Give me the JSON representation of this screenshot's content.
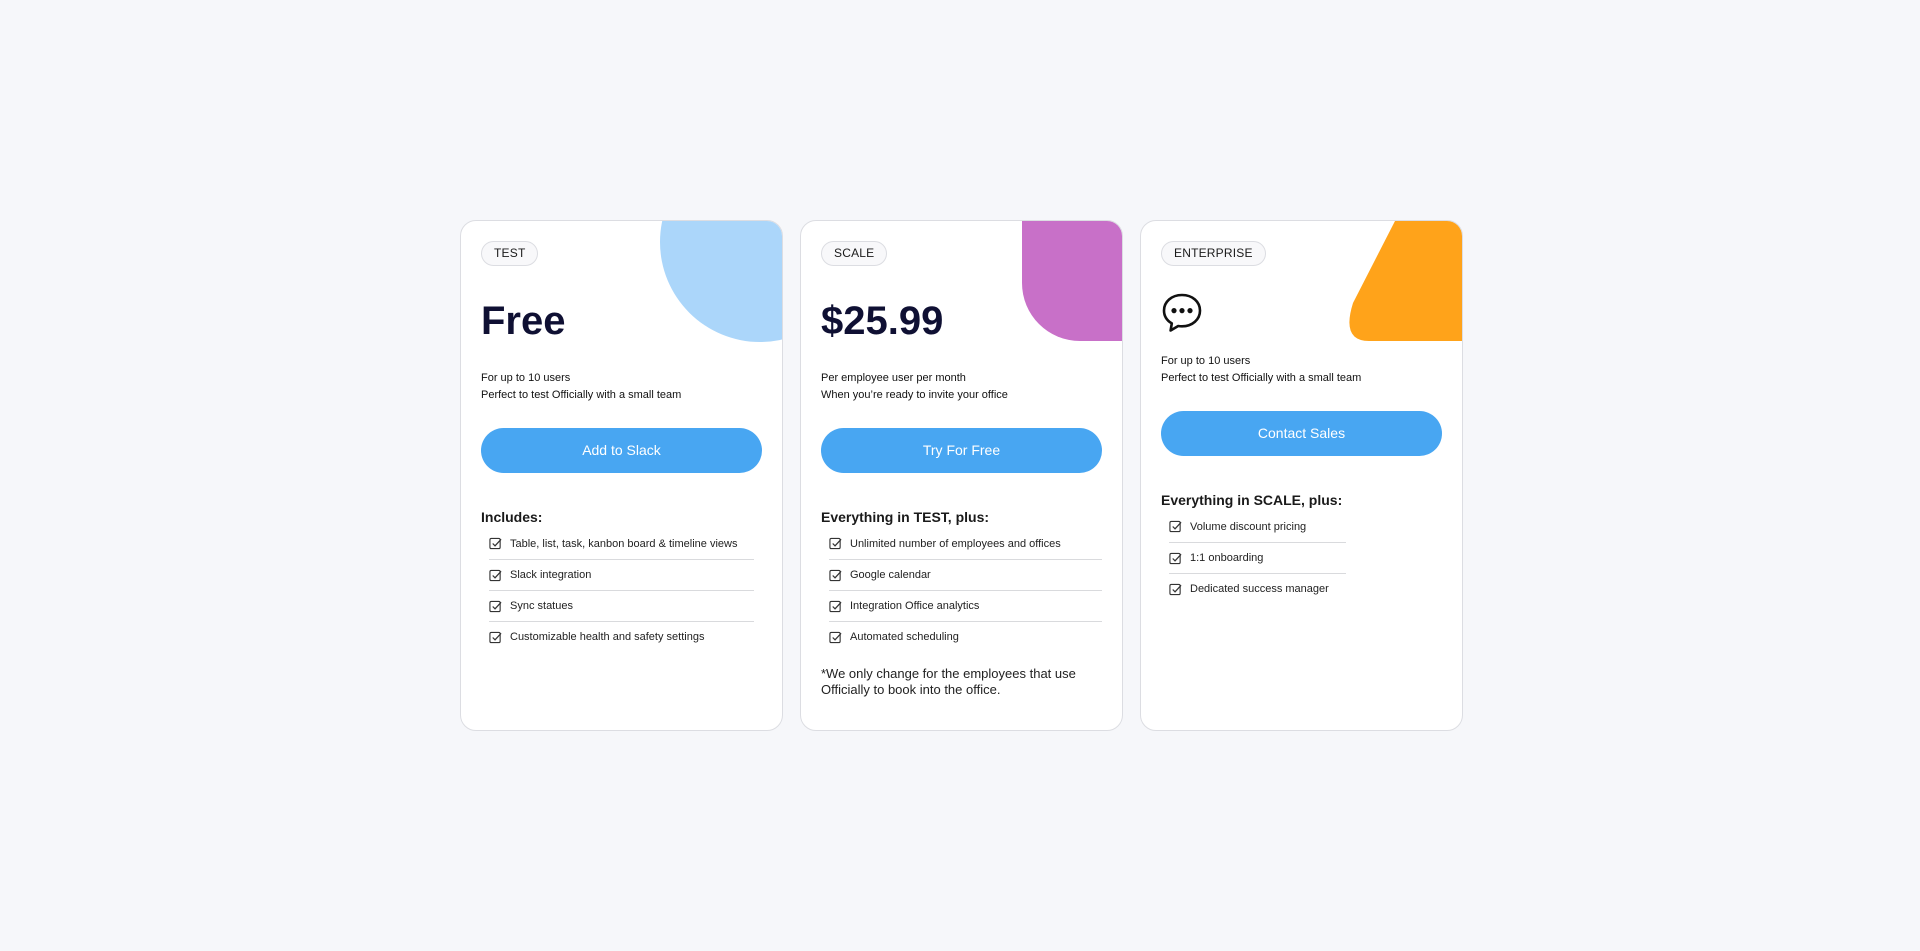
{
  "plans": [
    {
      "tier": "TEST",
      "price": "Free",
      "desc_line1": "For up to 10 users",
      "desc_line2": "Perfect to test Officially with a small team",
      "cta": "Add to Slack",
      "includes_title": "Includes:",
      "features": [
        "Table, list, task, kanbon board & timeline views",
        "Slack integration",
        "Sync statues",
        "Customizable health and safety settings"
      ],
      "accent_color": "#abd6fa"
    },
    {
      "tier": "SCALE",
      "price": "$25.99",
      "desc_line1": "Per employee user per month",
      "desc_line2": "When you’re ready to invite your office",
      "cta": "Try For Free",
      "includes_title": "Everything in TEST, plus:",
      "features": [
        "Unlimited number of employees and offices",
        "Google calendar",
        "Integration Office analytics",
        "Automated scheduling"
      ],
      "note": "*We only change for the employees that use Officially to book into the office.",
      "accent_color": "#c870c8"
    },
    {
      "tier": "ENTERPRISE",
      "price_icon": "chat-bubble-icon",
      "desc_line1": "For up to 10 users",
      "desc_line2": "Perfect to test Officially with a small team",
      "cta": "Contact Sales",
      "includes_title": "Everything in SCALE, plus:",
      "features": [
        "Volume discount pricing",
        "1:1 onboarding",
        "Dedicated success manager"
      ],
      "accent_color": "#ffa31a"
    }
  ],
  "colors": {
    "button": "#48a6f2",
    "price_text": "#0f1033",
    "background": "#f6f7fa"
  }
}
